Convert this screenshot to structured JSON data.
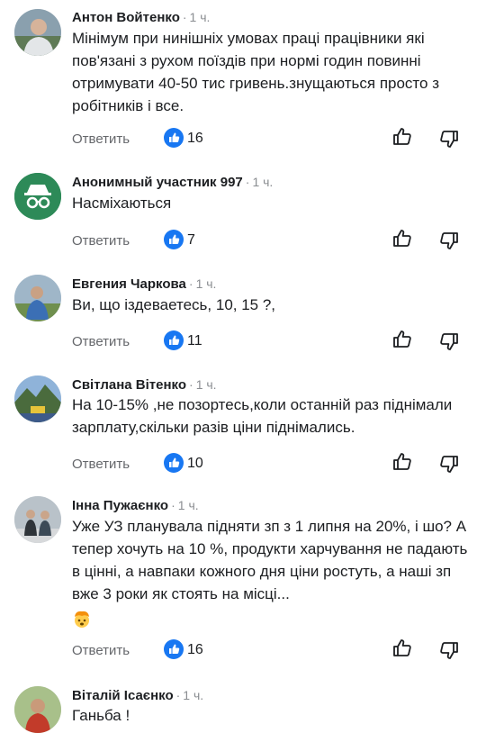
{
  "colors": {
    "accent": "#1877f2",
    "muted": "#65676b",
    "time": "#8a8d91"
  },
  "reply_label": "Ответить",
  "comments": [
    {
      "author": "Антон Войтенко",
      "time": "1 ч.",
      "text": "Мінімум при нинішніх умовах праці працівники які пов'язані з рухом поїздів при нормі годин повинні отримувати 40-50 тис гривень.знущаються просто з робітників і все.",
      "likes": "16"
    },
    {
      "author": "Анонимный участник 997",
      "time": "1 ч.",
      "text": "Насміхаються",
      "likes": "7"
    },
    {
      "author": "Евгения Чаркова",
      "time": "1 ч.",
      "text": "Ви, що іздеваетесь, 10, 15 ?,",
      "likes": "11"
    },
    {
      "author": "Світлана Вітенко",
      "time": "1 ч.",
      "text": "На 10-15% ,не позортесь,коли останній раз піднімали зарплату,скільки разів ціни піднімались.",
      "likes": "10"
    },
    {
      "author": "Інна Пужаєнко",
      "time": "1 ч.",
      "text": "Уже УЗ планувала підняти зп з 1 липня на 20%, і шо? А тепер хочуть на 10 %, продукти харчування не падають в цінні, а навпаки кожного дня ціни ростуть, а наші зп вже 3 роки як стоять на місці...",
      "emoji": "exploding-head-emoji",
      "likes": "16"
    },
    {
      "author": "Віталій Ісаєнко",
      "time": "1 ч.",
      "text": "Ганьба !"
    }
  ]
}
